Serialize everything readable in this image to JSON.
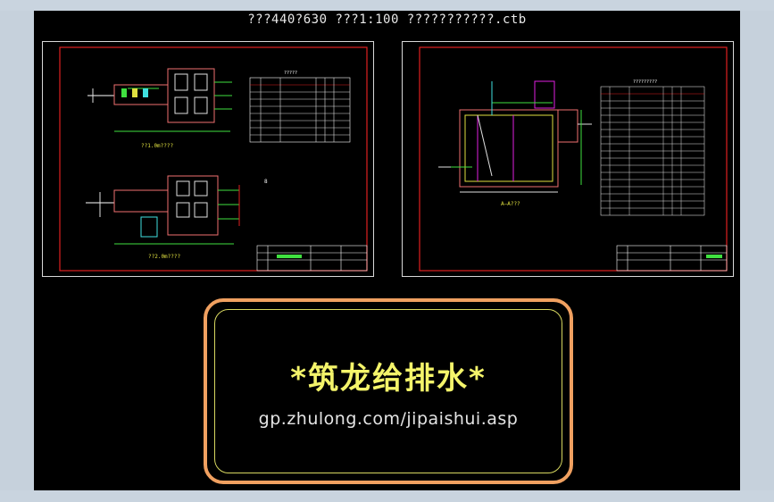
{
  "window": {
    "title": "???440?630  ???1:100    ???????????.ctb"
  },
  "sheet_left": {
    "plan_label_top": "??1.0m????",
    "plan_label_bottom": "??2.0m????",
    "table_title": "?????",
    "side_mark": "8"
  },
  "sheet_right": {
    "section_label": "A—A???",
    "table_title": "?????????"
  },
  "banner": {
    "title": "*筑龙给排水*",
    "url": "gp.zhulong.com/jipaishui.asp"
  },
  "colors": {
    "viewport_bg": "#000000",
    "frame": "#c6d1dc",
    "sheet_border_red": "#e02020",
    "banner_border": "#f0a060",
    "banner_title": "#f4f46a"
  }
}
